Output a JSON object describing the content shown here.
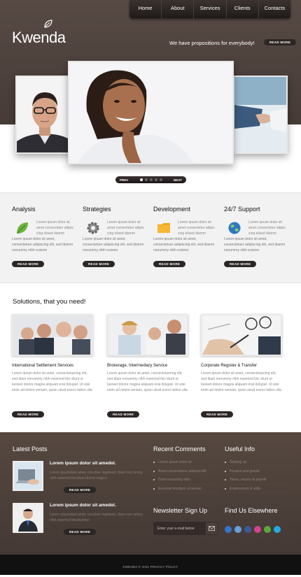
{
  "nav": [
    "Home",
    "About",
    "Services",
    "Clients",
    "Contacts"
  ],
  "logo": "Kwenda",
  "tagline": "We have propositions for everybody!",
  "more_label": "READ MORE",
  "slider": {
    "prev": "PREV",
    "next": "NEXT",
    "dot_count": 5,
    "active_dot": 1
  },
  "services": [
    {
      "title": "Analysis",
      "icon": "leaf-icon",
      "side": "Lorem ipsum dolor sit amet consectetur adipis cing elised diamm",
      "body": "Lorem ipsum dolor sit amet, consectetuer adipiscing elit, sed diamm nonummy nibh euismo"
    },
    {
      "title": "Strategies",
      "icon": "gear-icon",
      "side": "Lorem ipsum dolor sit amet consectetur adipis cing elised diamm",
      "body": "Lorem ipsum dolor sit amet, consectetuer adipiscing elit, sed diamm nonummy nibh euismo"
    },
    {
      "title": "Development",
      "icon": "folder-icon",
      "side": "Lorem ipsum dolor sit amet consectetur adipis cing elised diamm",
      "body": "Lorem ipsum dolor sit amet, consectetuer adipiscing elit, sed diamm nonummy nibh euismo"
    },
    {
      "title": "24/7 Support",
      "icon": "globe-icon",
      "side": "Lorem ipsum dolor sit amet consectetur adipis cing elised diamm",
      "body": "Lorem ipsum dolor sit amet, consectetuer adipiscing elit, sed diamm nonummy nibh euismo"
    }
  ],
  "solutions_title": "Solutions, that you need!",
  "solutions": [
    {
      "title": "International Settlement Services",
      "body": "Lorem ipsum dolor sit amet, consectetuering elit, sed diam nonummy nibh euismod tinc idunt ut laoreet dolore magna aliquam erat dolupat. Ut wisi enim ad minim veniam, quisn strud exerci tation ulla"
    },
    {
      "title": "Brokerage, Intermediary Service",
      "body": "Lorem ipsum dolor sit amet, consectetuering elit, sed diam nonummy nibh euismod tinc idunt ut laoreet dolore magna aliquam erat dolupat. Ut wisi enim ad minim veniam, quisn strud exerci tation ulla"
    },
    {
      "title": "Corporate Register & Transfer",
      "body": "Lorem ipsum dolor sit amet, consectetuering elit, sed diam nonummy nibh euismod tinc idunt ut laoreet dolore magna aliquam erat dolupat. Ut wisi enim ad minim veniam, quisn strud exerci tation ulla"
    }
  ],
  "footer": {
    "latest_posts_title": "Latest Posts",
    "posts": [
      {
        "title": "Lorem ipsum dolor sit amedol.",
        "body": "Lorem ipsumdoet amet, conctoer ingelised. diam non nmmy nihh euismod tincidunt dolore magnu"
      },
      {
        "title": "Lorem ipsum dolor sit amedol.",
        "body": "Lorem ipsumdoet amet, conctoer ingelised. diam non nmmy nihh euismod tincidunteut"
      }
    ],
    "recent_comments_title": "Recent Comments",
    "comments": [
      "Lorem ipsum dolor sit",
      "Amet consectetuer adipisonold",
      "Diam nonummy nibh",
      "Euismod tincidunt ut laoreet"
    ],
    "useful_info_title": "Useful Info",
    "useful": [
      "Starting up",
      "Finance and grants",
      "Taxes, returns & payroll",
      "Employment & skills"
    ],
    "newsletter_title": "Newsletter Sign Up",
    "newsletter_placeholder": "Enter your e-mail below",
    "find_us_title": "Find Us Elsewhere",
    "social_icons": [
      "delicious-icon",
      "digg-icon",
      "facebook-icon",
      "flickr-icon",
      "stumbleupon-icon",
      "skype-icon"
    ]
  },
  "copyright": "KWENDA © 2011 PRIVACY POLICY"
}
